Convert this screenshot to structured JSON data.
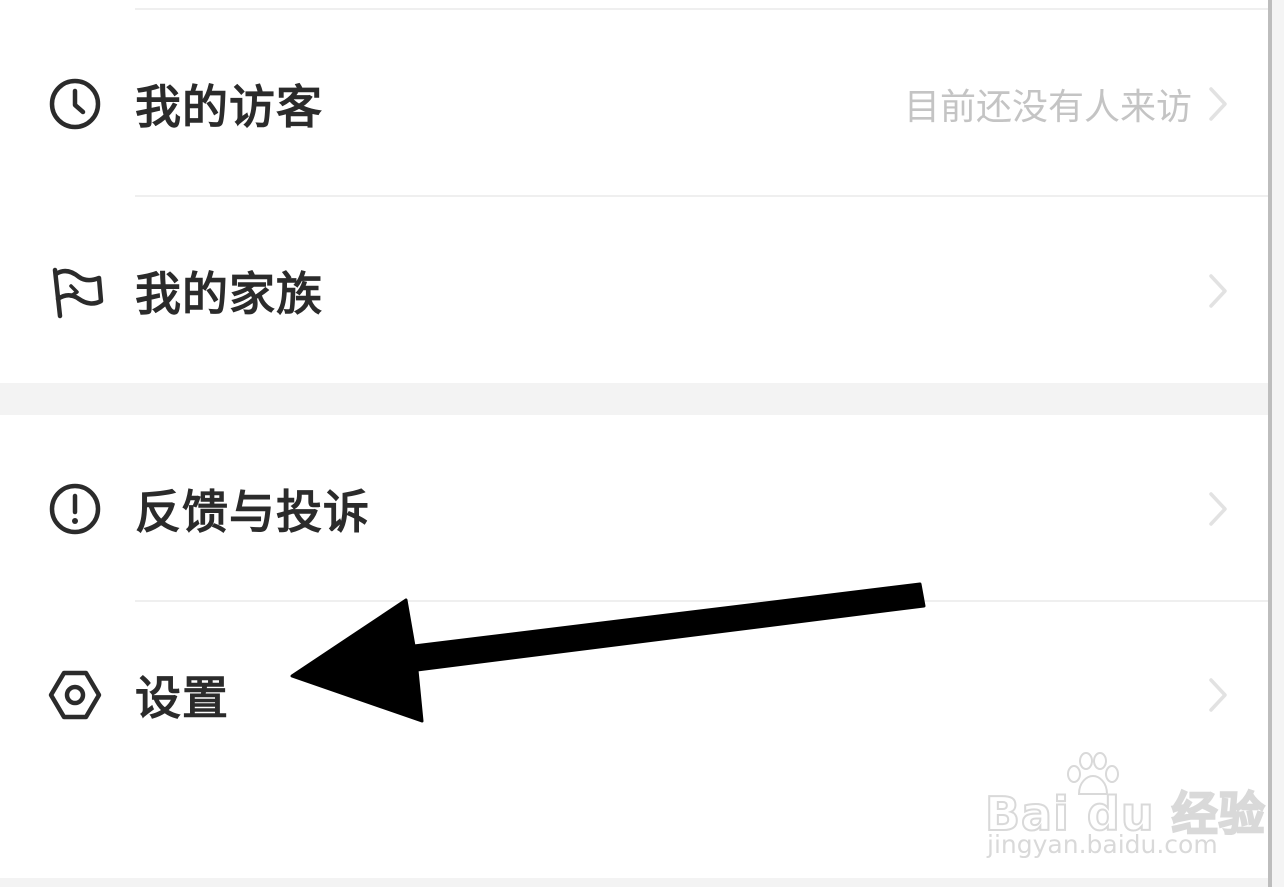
{
  "menu": {
    "items": [
      {
        "label": "我的访客",
        "value": "目前还没有人来访",
        "icon": "clock-icon"
      },
      {
        "label": "我的家族",
        "value": "",
        "icon": "flag-icon"
      },
      {
        "label": "反馈与投诉",
        "value": "",
        "icon": "alert-circle-icon"
      },
      {
        "label": "设置",
        "value": "",
        "icon": "gear-icon"
      }
    ]
  },
  "watermark": {
    "brand": "Bai du 经验",
    "url": "jingyan.baidu.com"
  },
  "annotation": {
    "arrow_target": "设置",
    "arrow_color": "#000000"
  }
}
